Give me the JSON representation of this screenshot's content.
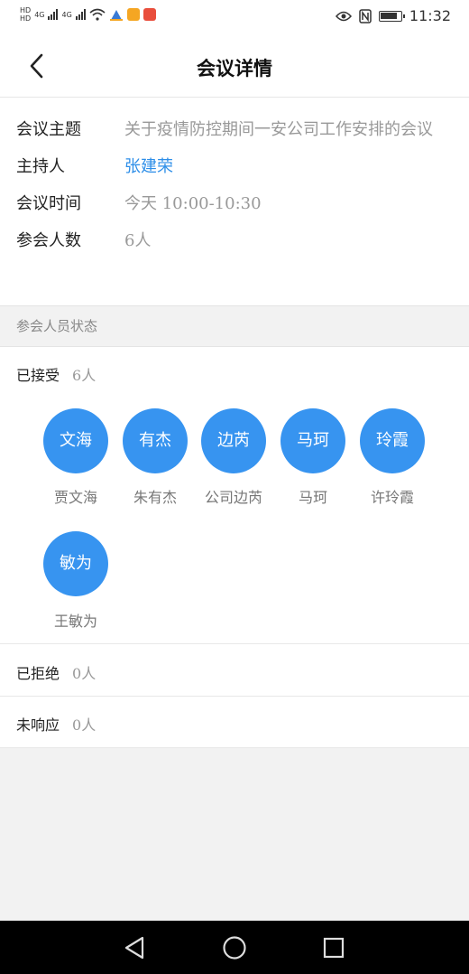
{
  "status_bar": {
    "hd1": "HD",
    "hd2": "HD",
    "net1": "4G",
    "net2": "4G",
    "time": "11:32",
    "icons": [
      "wifi-icon",
      "eye-icon",
      "nfc-icon",
      "battery-icon"
    ],
    "app_icon_colors": [
      "#f5a623",
      "#e94e3c"
    ]
  },
  "header": {
    "title": "会议详情",
    "back_icon": "chevron-left-icon"
  },
  "meeting": {
    "topic_label": "会议主题",
    "topic_value": "关于疫情防控期间一安公司工作安排的会议",
    "host_label": "主持人",
    "host_value": "张建荣",
    "time_label": "会议时间",
    "time_value": "今天 10:00-10:30",
    "count_label": "参会人数",
    "count_value": "6人"
  },
  "attendee_section": {
    "title": "参会人员状态",
    "accepted_label": "已接受",
    "accepted_count": "6人",
    "rejected_label": "已拒绝",
    "rejected_count": "0人",
    "noresponse_label": "未响应",
    "noresponse_count": "0人",
    "attendees": [
      {
        "initials": "文海",
        "name": "贾文海"
      },
      {
        "initials": "有杰",
        "name": "朱有杰"
      },
      {
        "initials": "边芮",
        "name": "公司边芮"
      },
      {
        "initials": "马珂",
        "name": "马珂"
      },
      {
        "initials": "玲霞",
        "name": "许玲霞"
      },
      {
        "initials": "敏为",
        "name": "王敏为"
      }
    ]
  },
  "colors": {
    "accent": "#3794f0",
    "link": "#2d8ee8"
  },
  "nav_bar": {
    "icons": [
      "back-triangle-icon",
      "home-circle-icon",
      "recents-square-icon"
    ]
  }
}
